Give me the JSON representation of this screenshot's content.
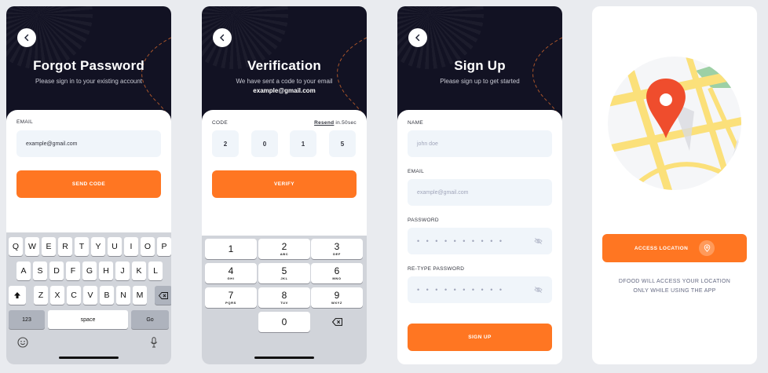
{
  "forgot": {
    "title": "Forgot Password",
    "subtitle": "Please sign in to your existing account",
    "email_label": "EMAIL",
    "email_value": "example@gmail.com",
    "send_button": "SEND CODE"
  },
  "keyboard": {
    "row1": [
      "Q",
      "W",
      "E",
      "R",
      "T",
      "Y",
      "U",
      "I",
      "O",
      "P"
    ],
    "row2": [
      "A",
      "S",
      "D",
      "F",
      "G",
      "H",
      "J",
      "K",
      "L"
    ],
    "row3": [
      "Z",
      "X",
      "C",
      "V",
      "B",
      "N",
      "M"
    ],
    "numbers_key": "123",
    "space_key": "space",
    "go_key": "Go"
  },
  "verification": {
    "title": "Verification",
    "subtitle": "We have sent a code to your email",
    "email": "example@gmail.com",
    "code_label": "CODE",
    "resend_label": "Resend",
    "resend_timer": "in.50sec",
    "digits": [
      "2",
      "0",
      "1",
      "5"
    ],
    "verify_button": "VERIFY"
  },
  "numpad": {
    "keys": [
      {
        "digit": "1",
        "letters": ""
      },
      {
        "digit": "2",
        "letters": "ABC"
      },
      {
        "digit": "3",
        "letters": "DEF"
      },
      {
        "digit": "4",
        "letters": "GHI"
      },
      {
        "digit": "5",
        "letters": "JKL"
      },
      {
        "digit": "6",
        "letters": "MNO"
      },
      {
        "digit": "7",
        "letters": "PQRS"
      },
      {
        "digit": "8",
        "letters": "TUV"
      },
      {
        "digit": "9",
        "letters": "WXYZ"
      },
      {
        "digit": "0",
        "letters": ""
      }
    ]
  },
  "signup": {
    "title": "Sign Up",
    "subtitle": "Please sign up to get started",
    "name_label": "NAME",
    "name_placeholder": "john doe",
    "email_label": "EMAIL",
    "email_placeholder": "example@gmail.com",
    "password_label": "PASSWORD",
    "password_value": "• • • • • • • • • •",
    "retype_label": "RE-TYPE PASSWORD",
    "retype_value": "• • • • • • • • • •",
    "signup_button": "SIGN UP"
  },
  "location": {
    "access_button": "ACCESS LOCATION",
    "notice_line1": "DFOOD WILL ACCESS YOUR LOCATION",
    "notice_line2": "ONLY WHILE USING THE APP"
  },
  "colors": {
    "accent": "#ff7622",
    "dark": "#121223",
    "field": "#f0f5fa"
  }
}
